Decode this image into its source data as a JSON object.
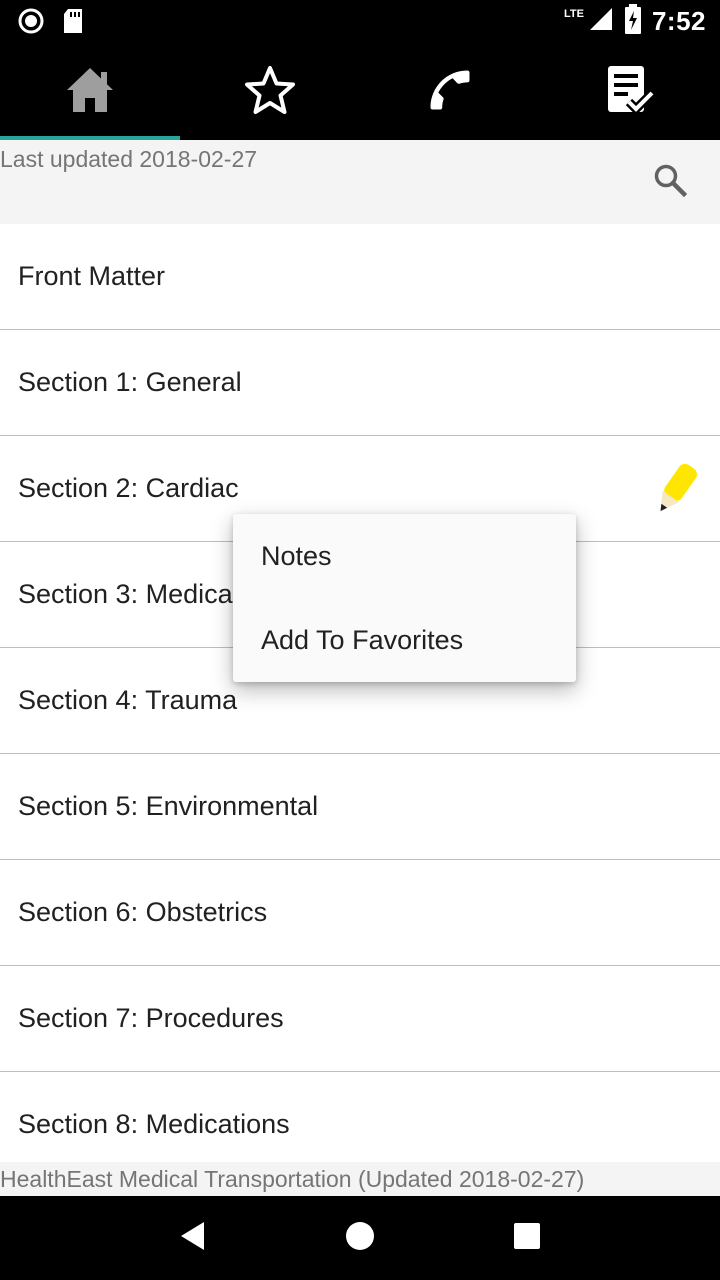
{
  "status_bar": {
    "time": "7:52",
    "network": "LTE",
    "icons": [
      "record-icon",
      "sd-card-icon",
      "signal-icon",
      "battery-charging-icon"
    ]
  },
  "tabs": [
    {
      "name": "home",
      "icon": "home-icon",
      "selected": true
    },
    {
      "name": "favorites",
      "icon": "star-icon",
      "selected": false
    },
    {
      "name": "phone",
      "icon": "phone-icon",
      "selected": false
    },
    {
      "name": "checklist",
      "icon": "checklist-icon",
      "selected": false
    }
  ],
  "header": {
    "last_updated": "Last updated 2018-02-27",
    "search_icon": "search-icon"
  },
  "list": {
    "items": [
      {
        "label": "Front Matter"
      },
      {
        "label": "Section 1: General"
      },
      {
        "label": "Section 2: Cardiac",
        "note_icon": "pencil-note-icon"
      },
      {
        "label": "Section 3: Medical"
      },
      {
        "label": "Section 4: Trauma"
      },
      {
        "label": "Section 5: Environmental"
      },
      {
        "label": "Section 6: Obstetrics"
      },
      {
        "label": "Section 7: Procedures"
      },
      {
        "label": "Section 8: Medications"
      }
    ]
  },
  "context_menu": {
    "items": [
      {
        "label": "Notes"
      },
      {
        "label": "Add To Favorites"
      }
    ]
  },
  "footer": {
    "text": "HealthEast Medical Transportation (Updated 2018-02-27)"
  },
  "nav_bar": {
    "buttons": [
      "back-icon",
      "home-circle-icon",
      "recents-icon"
    ]
  },
  "colors": {
    "accent": "#26a69a",
    "note_yellow": "#ffeb3b"
  }
}
